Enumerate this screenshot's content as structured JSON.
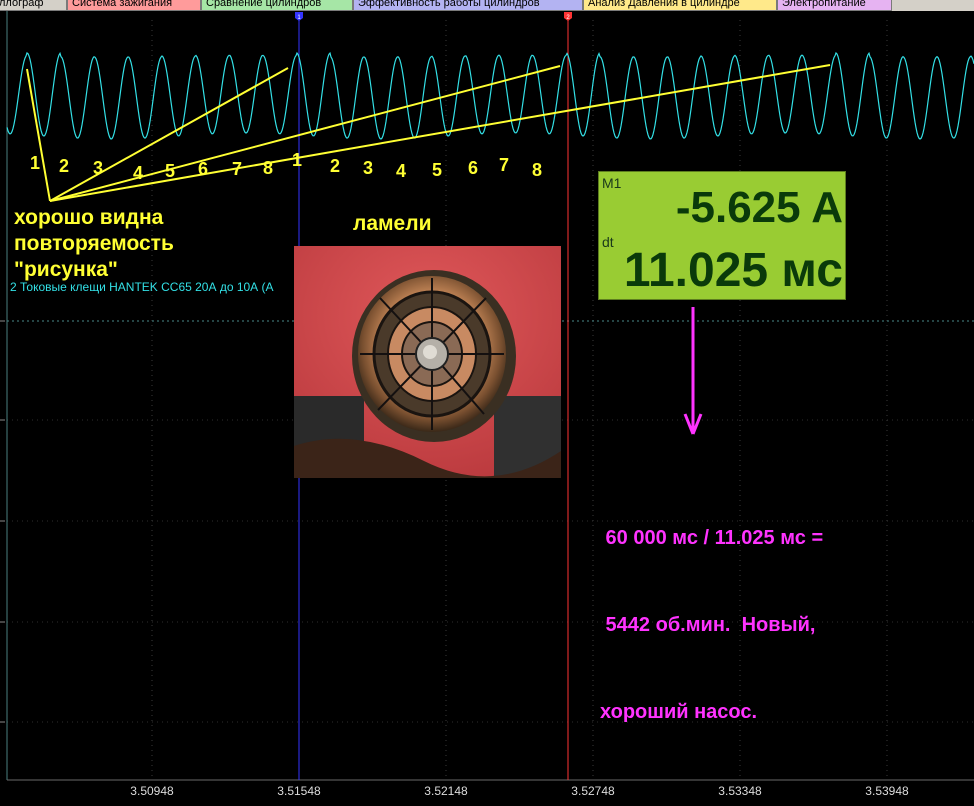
{
  "tabs": [
    {
      "label": "ллограф",
      "color": "#d4d0c8"
    },
    {
      "label": "Система зажигания",
      "color": "#ff9b9b"
    },
    {
      "label": "Сравнение цилиндров",
      "color": "#a6e6a6"
    },
    {
      "label": "Эффективность работы цилиндров",
      "color": "#b3b3f2"
    },
    {
      "label": "Анализ Давления в цилиндре",
      "color": "#ffe98a"
    },
    {
      "label": "Электропитание",
      "color": "#e6b3f2"
    }
  ],
  "cursors": {
    "c1_label": "1",
    "c2_label": "2"
  },
  "channel_label": "2 Токовые клещи HANTEK CC65 20А до 10А (А",
  "annotations": {
    "numbers_group1": [
      "1",
      "2",
      "3",
      "4",
      "5",
      "6",
      "7",
      "8"
    ],
    "numbers_group2": [
      "1",
      "2",
      "3",
      "4",
      "5",
      "6",
      "7",
      "8"
    ],
    "repeat_text": [
      "хорошо видна",
      "повторяемость",
      "\"рисунка\""
    ],
    "lamels_title": "ламели",
    "calc_text": [
      " 60 000 мс / 11.025 мс =",
      " 5442 об.мин.  Новый,",
      "хороший насос."
    ]
  },
  "measurement": {
    "m1_label": "M1",
    "m1_value": "-5.625 A",
    "dt_label": "dt",
    "dt_value": "11.025 мс"
  },
  "x_axis_ticks": [
    "3.50948",
    "3.51548",
    "3.52148",
    "3.52748",
    "3.53348",
    "3.53948"
  ],
  "colors": {
    "trace": "#33e0e6",
    "annotation": "#ffff33",
    "calc": "#ff33ff",
    "arrow": "#ff33ff",
    "cursor1": "#3333ff",
    "cursor2": "#ff3333",
    "panel_bg": "#99cc33",
    "panel_text": "#0a3a0a"
  }
}
